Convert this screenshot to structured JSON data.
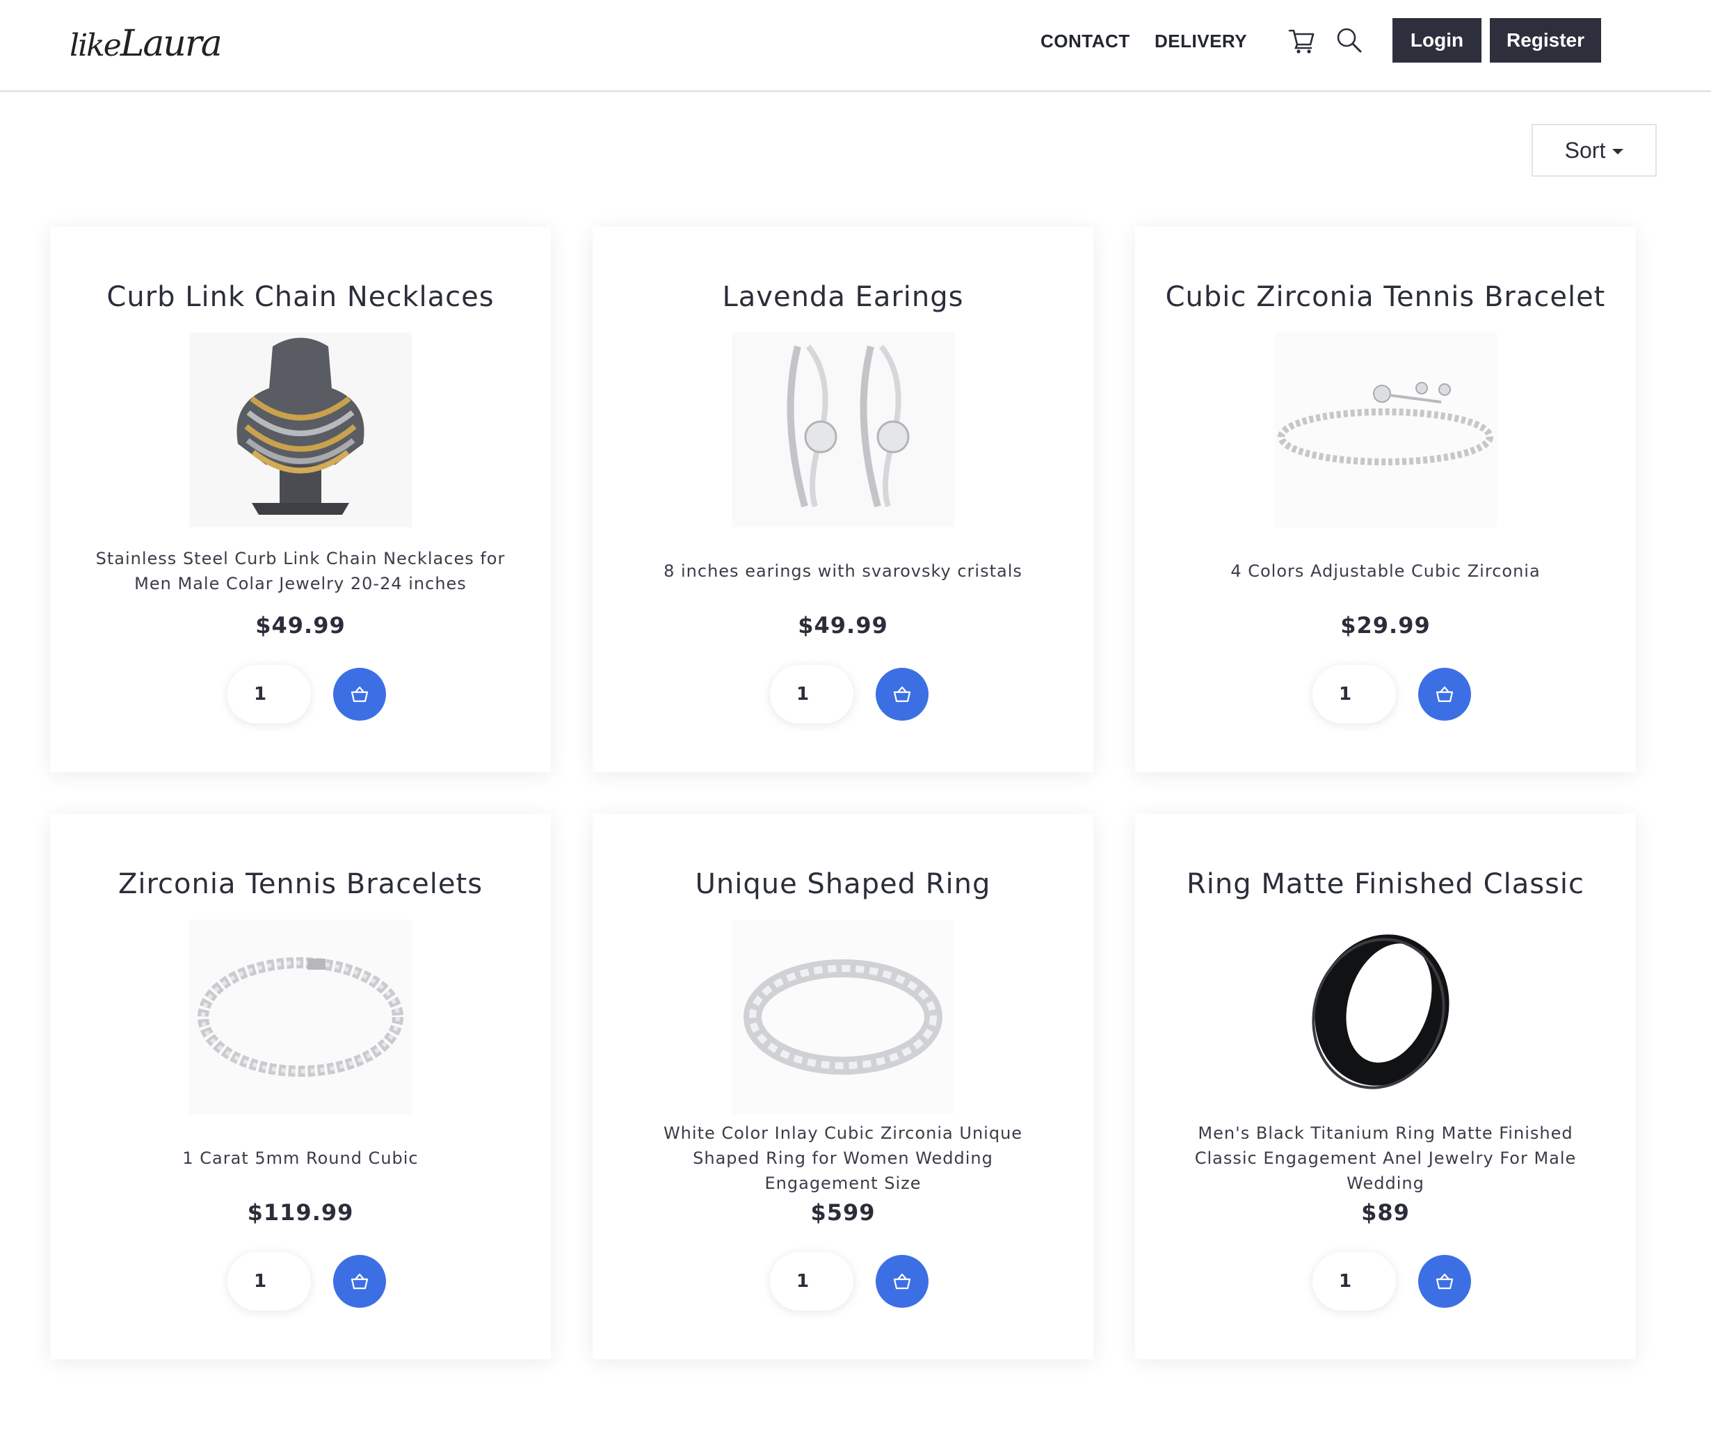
{
  "header": {
    "logo_part1": "like",
    "logo_part2": "Laura",
    "nav": {
      "contact": "CONTACT",
      "delivery": "DELIVERY"
    },
    "icons": [
      "cart-icon",
      "search-icon"
    ],
    "login_label": "Login",
    "register_label": "Register"
  },
  "toolbar": {
    "sort_label": "Sort"
  },
  "colors": {
    "primary": "#3d6fe4",
    "dark_button": "#2d2f3d",
    "text": "#2b2e3a"
  },
  "products": [
    {
      "title": "Curb Link Chain Necklaces",
      "description": "Stainless Steel Curb Link Chain Necklaces for Men Male Colar Jewelry 20-24 inches",
      "price": "$49.99",
      "quantity": "1",
      "image": "necklace-image"
    },
    {
      "title": "Lavenda Earings",
      "description": "8 inches earings with svarovsky cristals",
      "price": "$49.99",
      "quantity": "1",
      "image": "earrings-image"
    },
    {
      "title": "Cubic Zirconia Tennis Bracelet",
      "description": "4 Colors Adjustable Cubic Zirconia",
      "price": "$29.99",
      "quantity": "1",
      "image": "bracelet-image"
    },
    {
      "title": "Zirconia Tennis Bracelets",
      "description": "1 Carat 5mm Round Cubic",
      "price": "$119.99",
      "quantity": "1",
      "image": "tennis-bracelet-image"
    },
    {
      "title": "Unique Shaped Ring",
      "description": "White Color Inlay Cubic Zirconia Unique Shaped Ring for Women Wedding Engagement Size",
      "price": "$599",
      "quantity": "1",
      "image": "ring-image"
    },
    {
      "title": "Ring Matte Finished Classic",
      "description": "Men's Black Titanium Ring Matte Finished Classic Engagement Anel Jewelry For Male Wedding",
      "price": "$89",
      "quantity": "1",
      "image": "black-ring-image"
    }
  ]
}
